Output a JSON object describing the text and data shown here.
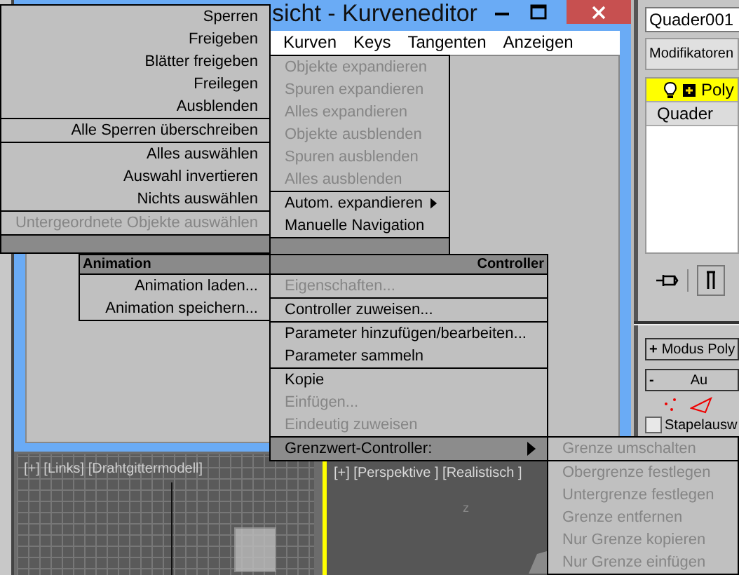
{
  "editor_window": {
    "title": "sicht - Kurveneditor",
    "menu": [
      "Kurven",
      "Keys",
      "Tangenten",
      "Anzeigen"
    ]
  },
  "quad_menu": {
    "top_left": {
      "items": [
        {
          "label": "Sperren",
          "disabled": false,
          "divider_above": false
        },
        {
          "label": "Freigeben",
          "disabled": false,
          "divider_above": false
        },
        {
          "label": "Blätter freigeben",
          "disabled": false,
          "divider_above": false
        },
        {
          "label": "Freilegen",
          "disabled": false,
          "divider_above": false
        },
        {
          "label": "Ausblenden",
          "disabled": false,
          "divider_above": false
        },
        {
          "label": "Alle Sperren überschreiben",
          "disabled": false,
          "divider_above": true
        },
        {
          "label": "Alles auswählen",
          "disabled": false,
          "divider_above": true
        },
        {
          "label": "Auswahl invertieren",
          "disabled": false,
          "divider_above": false
        },
        {
          "label": "Nichts auswählen",
          "disabled": false,
          "divider_above": false
        },
        {
          "label": "Untergeordnete Objekte auswählen",
          "disabled": true,
          "divider_above": true
        }
      ]
    },
    "top_right": {
      "items": [
        {
          "label": "Objekte expandieren",
          "disabled": true,
          "divider_above": false,
          "has_submenu": false
        },
        {
          "label": "Spuren expandieren",
          "disabled": true,
          "divider_above": false,
          "has_submenu": false
        },
        {
          "label": "Alles expandieren",
          "disabled": true,
          "divider_above": false,
          "has_submenu": false
        },
        {
          "label": "Objekte ausblenden",
          "disabled": true,
          "divider_above": false,
          "has_submenu": false
        },
        {
          "label": "Spuren ausblenden",
          "disabled": true,
          "divider_above": false,
          "has_submenu": false
        },
        {
          "label": "Alles ausblenden",
          "disabled": true,
          "divider_above": false,
          "has_submenu": false
        },
        {
          "label": "Autom. expandieren",
          "disabled": false,
          "divider_above": true,
          "has_submenu": true
        },
        {
          "label": "Manuelle Navigation",
          "disabled": false,
          "divider_above": false,
          "has_submenu": false
        }
      ]
    },
    "bottom_left": {
      "title": "Animation",
      "items": [
        {
          "label": "Animation laden...",
          "disabled": false,
          "divider_above": false
        },
        {
          "label": "Animation speichern...",
          "disabled": false,
          "divider_above": false
        }
      ]
    },
    "bottom_right": {
      "title": "Controller",
      "items": [
        {
          "label": "Eigenschaften...",
          "disabled": true,
          "divider_above": false,
          "has_submenu": false,
          "selected": false
        },
        {
          "label": "Controller zuweisen...",
          "disabled": false,
          "divider_above": true,
          "has_submenu": false,
          "selected": false
        },
        {
          "label": "Parameter hinzufügen/bearbeiten...",
          "disabled": false,
          "divider_above": true,
          "has_submenu": false,
          "selected": false
        },
        {
          "label": "Parameter sammeln",
          "disabled": false,
          "divider_above": false,
          "has_submenu": false,
          "selected": false
        },
        {
          "label": "Kopie",
          "disabled": false,
          "divider_above": true,
          "has_submenu": false,
          "selected": false
        },
        {
          "label": "Einfügen...",
          "disabled": true,
          "divider_above": false,
          "has_submenu": false,
          "selected": false
        },
        {
          "label": "Eindeutig zuweisen",
          "disabled": true,
          "divider_above": false,
          "has_submenu": false,
          "selected": false
        },
        {
          "label": "Grenzwert-Controller:",
          "disabled": false,
          "divider_above": true,
          "has_submenu": true,
          "selected": true
        }
      ]
    },
    "submenu": {
      "items": [
        {
          "label": "Grenze umschalten",
          "disabled": true,
          "divider_above": false
        },
        {
          "label": "Obergrenze festlegen",
          "disabled": true,
          "divider_above": true
        },
        {
          "label": "Untergrenze festlegen",
          "disabled": true,
          "divider_above": false
        },
        {
          "label": "Grenze entfernen",
          "disabled": true,
          "divider_above": false
        },
        {
          "label": "Nur Grenze kopieren",
          "disabled": true,
          "divider_above": false
        },
        {
          "label": "Nur Grenze einfügen",
          "disabled": true,
          "divider_above": false
        }
      ]
    }
  },
  "command_panel": {
    "object_name": "Quader001",
    "modifier_list": "Modifikatoren",
    "stack": [
      {
        "label": "Poly",
        "selected": true,
        "kind": "modifier"
      },
      {
        "label": "Quader",
        "selected": false,
        "kind": "base"
      }
    ],
    "rollouts": [
      {
        "sign": "+",
        "label": "Modus Poly"
      },
      {
        "sign": "-",
        "label": "Au"
      }
    ],
    "checkbox": {
      "label": "Stapelausw",
      "checked": false
    }
  },
  "viewports": [
    {
      "label": "[+] [Links] [Drahtgittermodell]",
      "active": false
    },
    {
      "label": "[+] [Perspektive ] [Realistisch ]",
      "active": true,
      "axis": "z"
    }
  ]
}
